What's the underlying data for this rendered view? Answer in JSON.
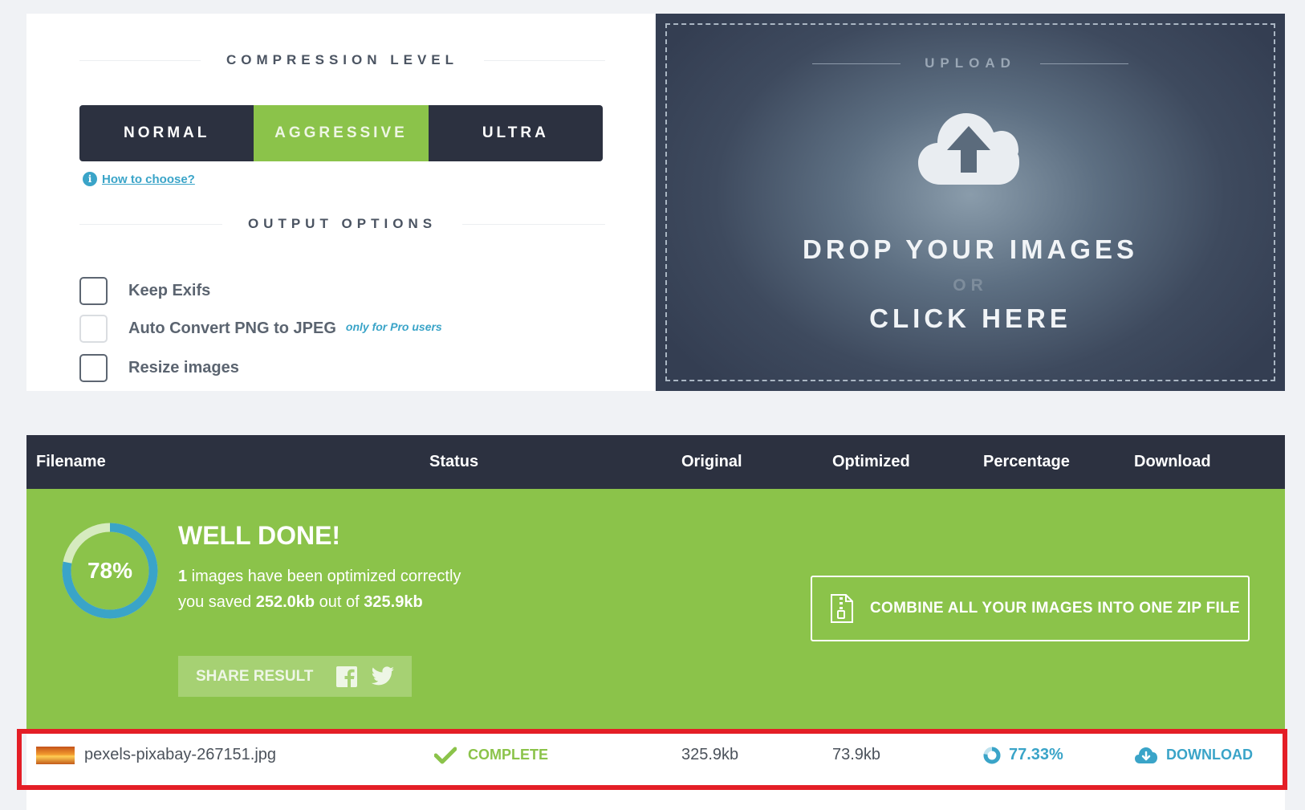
{
  "compression": {
    "title": "COMPRESSION LEVEL",
    "levels": [
      "NORMAL",
      "AGGRESSIVE",
      "ULTRA"
    ],
    "selected": "AGGRESSIVE",
    "help_link": "How to choose?"
  },
  "output": {
    "title": "OUTPUT OPTIONS",
    "options": [
      {
        "label": "Keep Exifs",
        "checked": false,
        "disabled": false
      },
      {
        "label": "Auto Convert PNG to JPEG",
        "checked": false,
        "disabled": true,
        "note": "only for Pro users"
      },
      {
        "label": "Resize images",
        "checked": false,
        "disabled": false
      }
    ]
  },
  "upload": {
    "title": "UPLOAD",
    "line1": "DROP YOUR IMAGES",
    "or": "OR",
    "line2": "CLICK HERE",
    "icon": "cloud-upload-icon"
  },
  "table": {
    "headers": [
      "Filename",
      "Status",
      "Original",
      "Optimized",
      "Percentage",
      "Download"
    ]
  },
  "summary": {
    "percent_label": "78%",
    "percent_value": 0.78,
    "title": "WELL DONE!",
    "count": "1",
    "count_text": " images have been optimized correctly",
    "saved_prefix": "you saved ",
    "saved": "252.0kb",
    "saved_mid": " out of ",
    "total": "325.9kb",
    "share_label": "SHARE RESULT",
    "zip_label": "COMBINE ALL YOUR IMAGES INTO ONE ZIP FILE"
  },
  "files": [
    {
      "filename": "pexels-pixabay-267151.jpg",
      "status": "COMPLETE",
      "original": "325.9kb",
      "optimized": "73.9kb",
      "percentage": "77.33%",
      "download": "DOWNLOAD"
    }
  ],
  "colors": {
    "accent_green": "#8bc34a",
    "dark_navy": "#2c3140",
    "link_blue": "#3aa4c8",
    "highlight_red": "#e41e26"
  }
}
